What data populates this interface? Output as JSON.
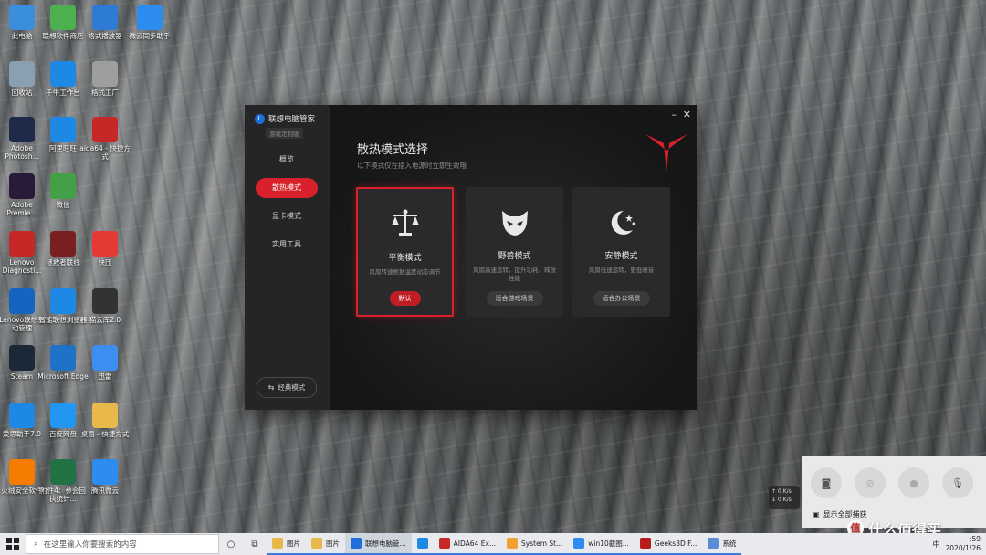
{
  "desktop": {
    "icons": [
      {
        "label": "此电脑",
        "icon": "computer-icon",
        "color": "#3b8edb"
      },
      {
        "label": "联想软件商店",
        "icon": "store-icon",
        "color": "#4caf50"
      },
      {
        "label": "格式播放器",
        "icon": "player-icon",
        "color": "#2e7bd6"
      },
      {
        "label": "微云同步助手",
        "icon": "cloud-icon",
        "color": "#2d8cf0"
      },
      {
        "label": "回收站",
        "icon": "recycle-bin-icon",
        "color": "#8aa0b0"
      },
      {
        "label": "千牛工作台",
        "icon": "qianniu-icon",
        "color": "#1e88e5"
      },
      {
        "label": "格式工厂",
        "icon": "factory-icon",
        "color": "#9e9e9e"
      },
      {
        "label": "Adobe Photosh...",
        "icon": "photoshop-icon",
        "color": "#1e2a4a"
      },
      {
        "label": "阿里旺旺",
        "icon": "wangwang-icon",
        "color": "#1e88e5"
      },
      {
        "label": "aida64 - 快捷方式",
        "icon": "aida64-icon",
        "color": "#c62828"
      },
      {
        "label": "Adobe Premie...",
        "icon": "premiere-icon",
        "color": "#2a1a3a"
      },
      {
        "label": "微信",
        "icon": "wechat-icon",
        "color": "#43a047"
      },
      {
        "label": "Lenovo Diagnosti...",
        "icon": "lenovo-diagnostics-icon",
        "color": "#c62828"
      },
      {
        "label": "拯救者联线",
        "icon": "legion-icon",
        "color": "#7a1f1f"
      },
      {
        "label": "快压",
        "icon": "kuaiya-icon",
        "color": "#e53935"
      },
      {
        "label": "Lenovo联想驱动管理",
        "icon": "driver-manager-icon",
        "color": "#1565c0"
      },
      {
        "label": "智能联想浏览器",
        "icon": "browser-icon",
        "color": "#1e88e5"
      },
      {
        "label": "猫云库2.0",
        "icon": "maoyun-icon",
        "color": "#333333"
      },
      {
        "label": "Steam",
        "icon": "steam-icon",
        "color": "#1b2838"
      },
      {
        "label": "Microsoft Edge",
        "icon": "edge-icon",
        "color": "#1e73c8"
      },
      {
        "label": "迅雷",
        "icon": "thunder-icon",
        "color": "#3d8ef0"
      },
      {
        "label": "爱思助手7.0",
        "icon": "i4-icon",
        "color": "#1e88e5"
      },
      {
        "label": "百度网盘",
        "icon": "baidu-netdisk-icon",
        "color": "#2196f3"
      },
      {
        "label": "桌面 - 快捷方式",
        "icon": "folder-icon",
        "color": "#e8b84a"
      },
      {
        "label": "火绒安全软件",
        "icon": "huorong-icon",
        "color": "#f57c00"
      },
      {
        "label": "附件4：参会回执统计...",
        "icon": "excel-icon",
        "color": "#217346"
      },
      {
        "label": "腾讯微云",
        "icon": "weiyun-icon",
        "color": "#2d8cf0"
      }
    ]
  },
  "app": {
    "title": "联想电脑管家",
    "subtitle": "游戏定制版",
    "nav": [
      {
        "label": "概览"
      },
      {
        "label": "散热模式"
      },
      {
        "label": "显卡模式"
      },
      {
        "label": "实用工具"
      }
    ],
    "classic_mode": "经典模式",
    "heading": "散热模式选择",
    "subheading": "以下模式仅在插入电源时立即生效哦",
    "modes": [
      {
        "title": "平衡模式",
        "desc": "风扇转速根据温度动态调节",
        "button": "默认"
      },
      {
        "title": "野兽模式",
        "desc": "风扇高速运转，提升功耗，释放性能",
        "button": "适合游戏场景"
      },
      {
        "title": "安静模式",
        "desc": "风扇低速运转，更低噪音",
        "button": "适合办公场景"
      }
    ],
    "accent": "#d8212a"
  },
  "quick_panel": {
    "show_all": "显示全部捕获"
  },
  "net_widget": {
    "up": "0 K/s",
    "down": "0 K/s"
  },
  "watermark": {
    "badge": "值",
    "text": "什么值得买"
  },
  "taskbar": {
    "search_placeholder": "在这里输入你要搜索的内容",
    "apps": [
      {
        "label": "图片",
        "color": "#e8b84a"
      },
      {
        "label": "图片",
        "color": "#e8b84a"
      },
      {
        "label": "联想电脑管...",
        "color": "#1e6fd9"
      },
      {
        "label": "",
        "color": "#1e88e5"
      },
      {
        "label": "AIDA64 Ex...",
        "color": "#c62828"
      },
      {
        "label": "System St...",
        "color": "#f0a030"
      },
      {
        "label": "win10截图...",
        "color": "#2d8cf0"
      },
      {
        "label": "Geeks3D F...",
        "color": "#b71c1c"
      },
      {
        "label": "系统",
        "color": "#5b8dd6"
      }
    ],
    "ime": "中",
    "time": ":59",
    "date": "2020/1/26"
  }
}
